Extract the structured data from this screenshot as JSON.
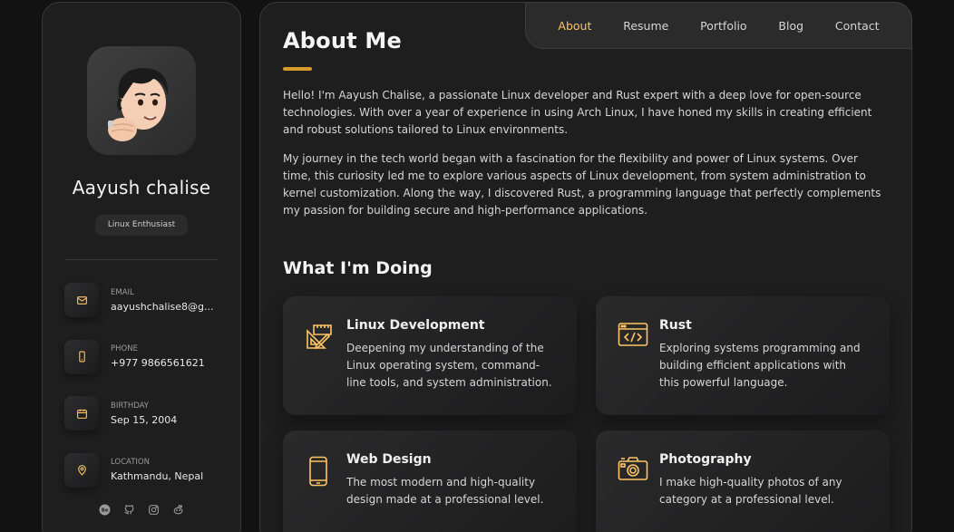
{
  "profile": {
    "name": "Aayush chalise",
    "role": "Linux Enthusiast"
  },
  "contacts": [
    {
      "icon": "mail-icon",
      "label": "EMAIL",
      "value": "aayushchalise8@g..."
    },
    {
      "icon": "phone-icon",
      "label": "PHONE",
      "value": "+977 9866561621"
    },
    {
      "icon": "calendar-icon",
      "label": "BIRTHDAY",
      "value": "Sep 15, 2004"
    },
    {
      "icon": "location-icon",
      "label": "LOCATION",
      "value": "Kathmandu, Nepal"
    }
  ],
  "socials": [
    "behance-icon",
    "github-icon",
    "instagram-icon",
    "reddit-icon"
  ],
  "nav": {
    "items": [
      "About",
      "Resume",
      "Portfolio",
      "Blog",
      "Contact"
    ],
    "active": "About"
  },
  "about": {
    "heading": "About Me",
    "paragraphs": [
      "Hello! I'm Aayush Chalise, a passionate Linux developer and Rust expert with a deep love for open-source technologies. With over a year of experience in using Arch Linux, I have honed my skills in creating efficient and robust solutions tailored to Linux environments.",
      "My journey in the tech world began with a fascination for the flexibility and power of Linux systems. Over time, this curiosity led me to explore various aspects of Linux development, from system administration to kernel customization. Along the way, I discovered Rust, a programming language that perfectly complements my passion for building secure and high-performance applications."
    ]
  },
  "doing": {
    "title": "What I'm Doing",
    "services": [
      {
        "icon": "design-tools-icon",
        "title": "Linux Development",
        "text": "Deepening my understanding of the Linux operating system, command-line tools, and system administration."
      },
      {
        "icon": "code-window-icon",
        "title": "Rust",
        "text": "Exploring systems programming and building efficient applications with this powerful language."
      },
      {
        "icon": "smartphone-icon",
        "title": "Web Design",
        "text": "The most modern and high-quality design made at a professional level."
      },
      {
        "icon": "camera-icon",
        "title": "Photography",
        "text": "I make high-quality photos of any category at a professional level."
      }
    ]
  },
  "colors": {
    "accent": "#ffc563",
    "bar": "#d69a2d",
    "background": "#121212",
    "panel": "#1e1e1f"
  }
}
